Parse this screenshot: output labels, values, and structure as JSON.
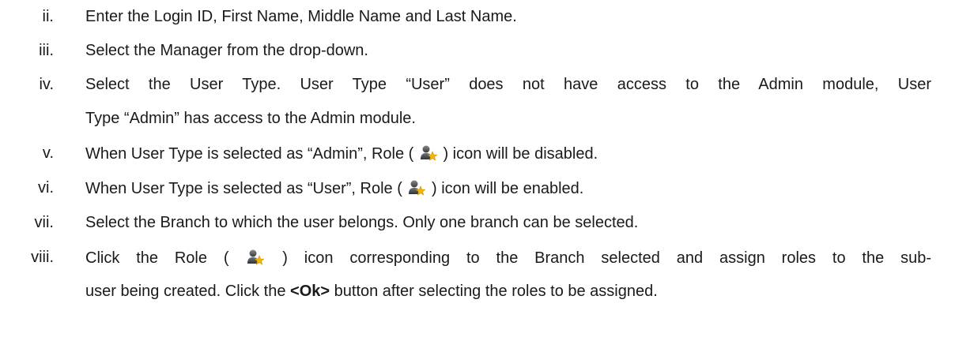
{
  "steps": [
    {
      "numeral": "ii.",
      "lines": [
        "Enter the Login ID, First Name, Middle Name and Last Name."
      ]
    },
    {
      "numeral": "iii.",
      "lines": [
        "Select the Manager from the drop-down."
      ]
    },
    {
      "numeral": "iv.",
      "lines": [
        "Select the User Type. User Type “User” does not have access to the Admin module, User",
        "Type “Admin” has access to the Admin module."
      ]
    },
    {
      "numeral": "v.",
      "text_before_icon": "When User Type is selected as “Admin”, Role (",
      "text_after_icon": ") icon will be disabled."
    },
    {
      "numeral": "vi.",
      "text_before_icon": "When User Type is selected as “User”, Role (",
      "text_after_icon": ") icon will be enabled."
    },
    {
      "numeral": "vii.",
      "lines": [
        "Select the Branch to which the user belongs. Only one branch can be selected."
      ]
    },
    {
      "numeral": "viii.",
      "text_before_icon": "Click the Role (",
      "text_after_icon": ") icon corresponding to the Branch selected and assign roles to the sub-",
      "line2_before_bold": "user being created. Click the ",
      "line2_bold": "<Ok>",
      "line2_after_bold": " button after selecting the roles to be assigned."
    }
  ],
  "icons": {
    "role_icon": "user-role-icon"
  }
}
